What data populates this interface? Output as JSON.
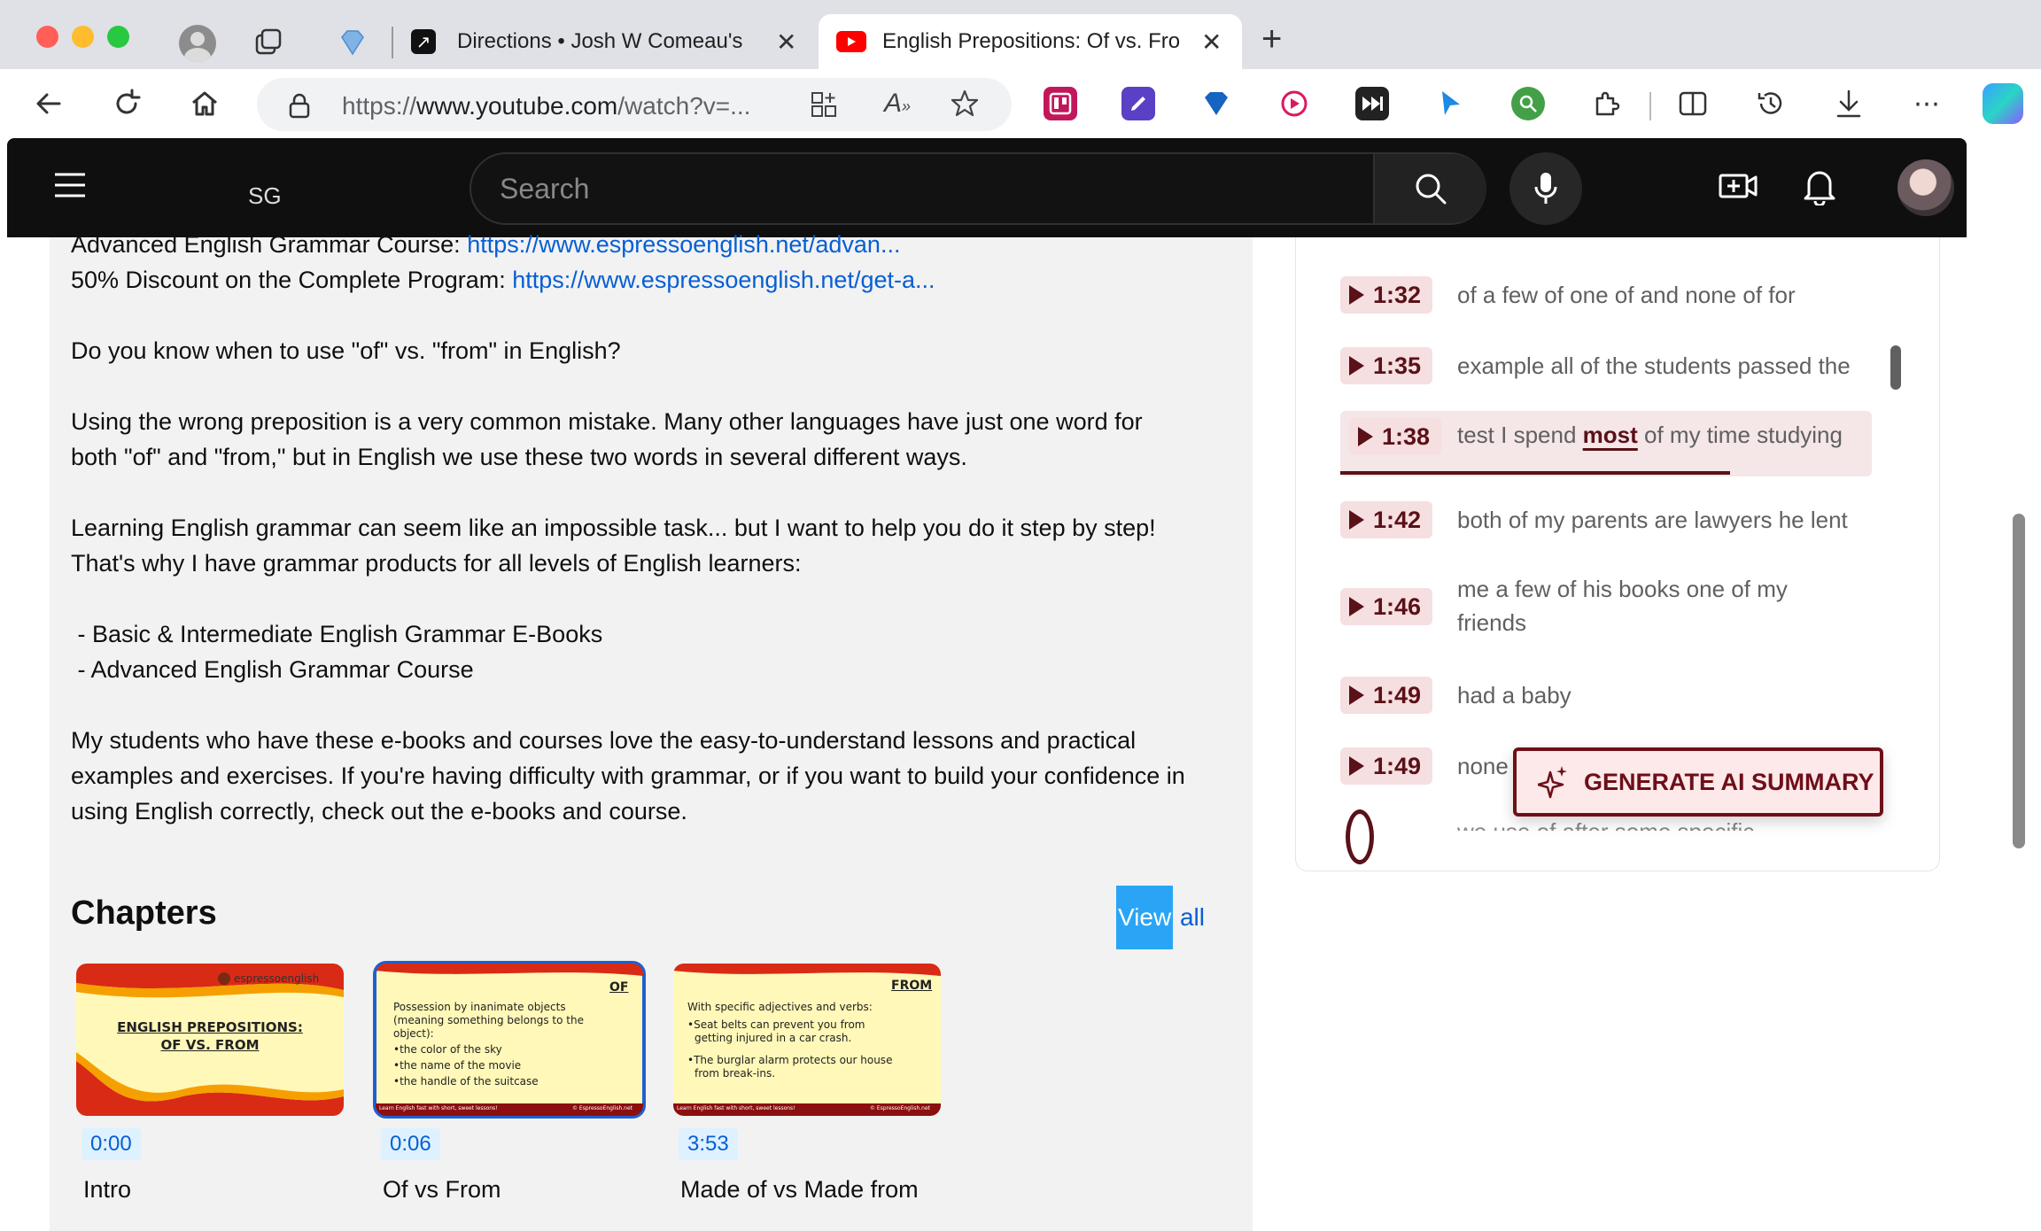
{
  "browser": {
    "tabs": [
      {
        "title": "Directions • Josh W Comeau's"
      },
      {
        "title": "English Prepositions: Of vs. Fro"
      }
    ],
    "new_tab": "+",
    "url_prefix": "https://",
    "url_host": "www.youtube.com",
    "url_rest": "/watch?v=..."
  },
  "youtube": {
    "logo_text": "SG",
    "search_placeholder": "Search"
  },
  "description": {
    "line1_label": "Advanced English Grammar Course: ",
    "line1_link": "https://www.espressoenglish.net/advan...",
    "line2_label": "50% Discount on the Complete Program: ",
    "line2_link": "https://www.espressoenglish.net/get-a...",
    "p1": "Do you know when to use \"of\" vs. \"from\" in English?",
    "p2a": "Using the wrong preposition is a very common mistake. Many other languages have just one word for",
    "p2b": "both \"of\" and \"from,\" but in English we use these two words in several different ways.",
    "p3a": "Learning English grammar can seem like an impossible task... but I want to help you do it step by step!",
    "p3b": "That's why I have grammar products for all levels of English learners:",
    "li1": " - Basic & Intermediate English Grammar E-Books",
    "li2": " - Advanced English Grammar Course",
    "p4a": "My students who have these e-books and courses love the easy-to-understand lessons and practical",
    "p4b": "examples and exercises. If you're having difficulty with grammar, or if you want to build your confidence in",
    "p4c": "using English correctly, check out the e-books and course."
  },
  "chapters": {
    "title": "Chapters",
    "view_all_a": "View",
    "view_all_b": " all",
    "items": [
      {
        "time": "0:00",
        "title": "Intro",
        "thumb_brand": "espressoenglish",
        "thumb_title_1": "ENGLISH PREPOSITIONS:",
        "thumb_title_2": "OF VS. FROM"
      },
      {
        "time": "0:06",
        "title": "Of vs From",
        "thumb_tag": "OF",
        "thumb_l1": "Possession by inanimate objects",
        "thumb_l2": "(meaning something belongs to the",
        "thumb_l3": "object):",
        "thumb_l4": "•the color of the sky",
        "thumb_l5": "•the name of the movie",
        "thumb_l6": "•the handle of the suitcase",
        "thumb_footer_l": "Learn English fast with short, sweet lessons!",
        "thumb_footer_r": "© EspressoEnglish.net"
      },
      {
        "time": "3:53",
        "title": "Made of vs Made from",
        "thumb_tag": "FROM",
        "thumb_l1": "With specific adjectives and verbs:",
        "thumb_l2": "•Seat belts can prevent you from",
        "thumb_l3": "getting injured in a car crash.",
        "thumb_l4": "•The burglar alarm protects our house",
        "thumb_l5": "from break-ins.",
        "thumb_footer_l": "Learn English fast with short, sweet lessons!",
        "thumb_footer_r": "© EspressoEnglish.net"
      }
    ]
  },
  "transcript": {
    "segments": [
      {
        "time": "1:32",
        "text": "of a few of one of and none of for"
      },
      {
        "time": "1:35",
        "text": "example all of the students passed the"
      },
      {
        "time": "1:38",
        "text_a": "test I spend ",
        "text_b": "most",
        "text_c": " of my time studying"
      },
      {
        "time": "1:42",
        "text": "both of my parents are lawyers he lent"
      },
      {
        "time": "1:46",
        "text": "me a few of his books one of my",
        "text2": "friends"
      },
      {
        "time": "1:49",
        "text": "had a baby"
      },
      {
        "time": "1:49",
        "text": "none"
      }
    ],
    "partial_text": "we use of after some specific",
    "ai_button": "GENERATE AI SUMMARY"
  }
}
